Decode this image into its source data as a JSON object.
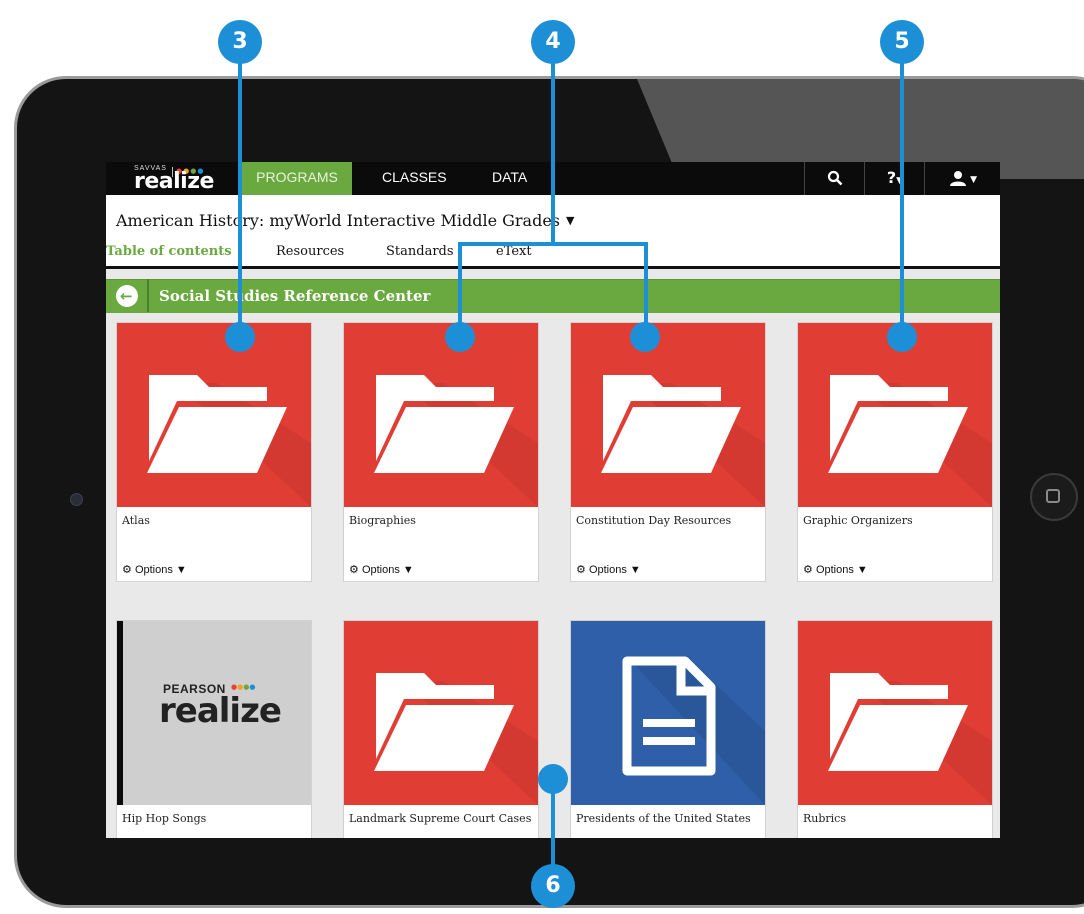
{
  "app": {
    "logo_brand_top": "SAVVAS",
    "logo_word": "realize",
    "nav": {
      "programs": "PROGRAMS",
      "classes": "CLASSES",
      "data": "DATA"
    },
    "icons": {
      "search": "search-icon",
      "help": "help-icon",
      "user": "user-icon"
    },
    "help_label": "?",
    "accent_color": "#6aa840"
  },
  "program": {
    "title": "American History: myWorld Interactive Middle Grades",
    "tabs": [
      "Table of contents",
      "Resources",
      "Standards",
      "eText"
    ]
  },
  "section": {
    "title": "Social Studies Reference Center"
  },
  "cards": [
    {
      "label": "Atlas",
      "type": "folder",
      "options": "Options"
    },
    {
      "label": "Biographies",
      "type": "folder",
      "options": "Options"
    },
    {
      "label": "Constitution Day Resources",
      "type": "folder",
      "options": "Options"
    },
    {
      "label": "Graphic Organizers",
      "type": "folder",
      "options": "Options"
    },
    {
      "label": "Hip Hop Songs",
      "type": "realize-logo",
      "logo_top": "PEARSON",
      "logo_word": "realize"
    },
    {
      "label": "Landmark Supreme Court Cases",
      "type": "folder"
    },
    {
      "label": "Presidents of the United States",
      "type": "document"
    },
    {
      "label": "Rubrics",
      "type": "folder"
    }
  ],
  "callouts": [
    "3",
    "4",
    "5",
    "6"
  ],
  "colors": {
    "callout": "#1d8fd6",
    "folder_bg": "#e03e35",
    "doc_bg": "#2e5fa8"
  }
}
